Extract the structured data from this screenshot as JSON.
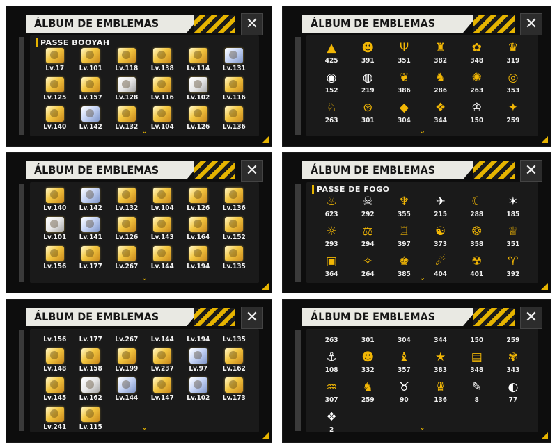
{
  "panels": [
    {
      "title": "ÁLBUM DE EMBLEMAS",
      "close_icon": "✕",
      "section": "PASSE BOOYAH",
      "kind": "levels",
      "items": [
        {
          "label": "Lv.17",
          "tone": "gold"
        },
        {
          "label": "Lv.101",
          "tone": "gold"
        },
        {
          "label": "Lv.118",
          "tone": "gold"
        },
        {
          "label": "Lv.138",
          "tone": "gold"
        },
        {
          "label": "Lv.114",
          "tone": "gold"
        },
        {
          "label": "Lv.131",
          "tone": "blue"
        },
        {
          "label": "Lv.125",
          "tone": "gold"
        },
        {
          "label": "Lv.157",
          "tone": "gold"
        },
        {
          "label": "Lv.128",
          "tone": "white"
        },
        {
          "label": "Lv.116",
          "tone": "gold"
        },
        {
          "label": "Lv.102",
          "tone": "white"
        },
        {
          "label": "Lv.116",
          "tone": "gold"
        },
        {
          "label": "Lv.140",
          "tone": "gold"
        },
        {
          "label": "Lv.142",
          "tone": "blue"
        },
        {
          "label": "Lv.132",
          "tone": "gold"
        },
        {
          "label": "Lv.104",
          "tone": "gold"
        },
        {
          "label": "Lv.126",
          "tone": "gold"
        },
        {
          "label": "Lv.136",
          "tone": "gold"
        }
      ]
    },
    {
      "title": "ÁLBUM DE EMBLEMAS",
      "close_icon": "✕",
      "section": "",
      "kind": "counts",
      "items": [
        {
          "icon": "▲",
          "label": "425",
          "tone": "gold"
        },
        {
          "icon": "☻",
          "label": "391",
          "tone": "gold"
        },
        {
          "icon": "Ψ",
          "label": "351",
          "tone": "gold"
        },
        {
          "icon": "♜",
          "label": "382",
          "tone": "gold"
        },
        {
          "icon": "✿",
          "label": "348",
          "tone": "gold"
        },
        {
          "icon": "♛",
          "label": "319",
          "tone": "gold"
        },
        {
          "icon": "◉",
          "label": "152",
          "tone": "white"
        },
        {
          "icon": "◍",
          "label": "219",
          "tone": "white"
        },
        {
          "icon": "❦",
          "label": "386",
          "tone": "gold"
        },
        {
          "icon": "♞",
          "label": "286",
          "tone": "gold"
        },
        {
          "icon": "✺",
          "label": "263",
          "tone": "gold"
        },
        {
          "icon": "◎",
          "label": "353",
          "tone": "gold"
        },
        {
          "icon": "♘",
          "label": "263",
          "tone": "gold"
        },
        {
          "icon": "⊛",
          "label": "301",
          "tone": "gold"
        },
        {
          "icon": "◆",
          "label": "304",
          "tone": "gold"
        },
        {
          "icon": "❖",
          "label": "344",
          "tone": "gold"
        },
        {
          "icon": "♔",
          "label": "150",
          "tone": "white"
        },
        {
          "icon": "✦",
          "label": "259",
          "tone": "gold"
        }
      ]
    },
    {
      "title": "ÁLBUM DE EMBLEMAS",
      "close_icon": "✕",
      "section": "",
      "kind": "levels",
      "items": [
        {
          "label": "Lv.140",
          "tone": "gold"
        },
        {
          "label": "Lv.142",
          "tone": "blue"
        },
        {
          "label": "Lv.132",
          "tone": "gold"
        },
        {
          "label": "Lv.104",
          "tone": "gold"
        },
        {
          "label": "Lv.126",
          "tone": "gold"
        },
        {
          "label": "Lv.136",
          "tone": "gold"
        },
        {
          "label": "Lv.101",
          "tone": "white"
        },
        {
          "label": "Lv.141",
          "tone": "blue"
        },
        {
          "label": "Lv.126",
          "tone": "gold"
        },
        {
          "label": "Lv.143",
          "tone": "gold"
        },
        {
          "label": "Lv.164",
          "tone": "gold"
        },
        {
          "label": "Lv.152",
          "tone": "gold"
        },
        {
          "label": "Lv.156",
          "tone": "gold"
        },
        {
          "label": "Lv.177",
          "tone": "gold"
        },
        {
          "label": "Lv.267",
          "tone": "gold"
        },
        {
          "label": "Lv.144",
          "tone": "gold"
        },
        {
          "label": "Lv.194",
          "tone": "gold"
        },
        {
          "label": "Lv.135",
          "tone": "gold"
        }
      ]
    },
    {
      "title": "ÁLBUM DE EMBLEMAS",
      "close_icon": "✕",
      "section": "PASSE DE FOGO",
      "kind": "counts",
      "items": [
        {
          "icon": "♨",
          "label": "623",
          "tone": "gold"
        },
        {
          "icon": "☠",
          "label": "292",
          "tone": "white"
        },
        {
          "icon": "♆",
          "label": "355",
          "tone": "gold"
        },
        {
          "icon": "✈",
          "label": "215",
          "tone": "white"
        },
        {
          "icon": "☾",
          "label": "288",
          "tone": "gold"
        },
        {
          "icon": "✶",
          "label": "185",
          "tone": "white"
        },
        {
          "icon": "☼",
          "label": "293",
          "tone": "gold"
        },
        {
          "icon": "⚖",
          "label": "294",
          "tone": "gold"
        },
        {
          "icon": "♖",
          "label": "397",
          "tone": "gold"
        },
        {
          "icon": "☯",
          "label": "373",
          "tone": "gold"
        },
        {
          "icon": "❂",
          "label": "358",
          "tone": "gold"
        },
        {
          "icon": "♕",
          "label": "351",
          "tone": "gold"
        },
        {
          "icon": "▣",
          "label": "364",
          "tone": "gold"
        },
        {
          "icon": "✧",
          "label": "264",
          "tone": "gold"
        },
        {
          "icon": "♚",
          "label": "385",
          "tone": "gold"
        },
        {
          "icon": "☄",
          "label": "404",
          "tone": "gold"
        },
        {
          "icon": "☢",
          "label": "401",
          "tone": "gold"
        },
        {
          "icon": "♈",
          "label": "392",
          "tone": "gold"
        }
      ]
    },
    {
      "title": "ÁLBUM DE EMBLEMAS",
      "close_icon": "✕",
      "section": "",
      "kind": "levels",
      "items": [
        {
          "label": "Lv.156",
          "tone": "none"
        },
        {
          "label": "Lv.177",
          "tone": "none"
        },
        {
          "label": "Lv.267",
          "tone": "none"
        },
        {
          "label": "Lv.144",
          "tone": "none"
        },
        {
          "label": "Lv.194",
          "tone": "none"
        },
        {
          "label": "Lv.135",
          "tone": "none"
        },
        {
          "label": "Lv.148",
          "tone": "gold"
        },
        {
          "label": "Lv.158",
          "tone": "gold"
        },
        {
          "label": "Lv.199",
          "tone": "gold"
        },
        {
          "label": "Lv.237",
          "tone": "gold"
        },
        {
          "label": "Lv.97",
          "tone": "blue"
        },
        {
          "label": "Lv.162",
          "tone": "gold"
        },
        {
          "label": "Lv.145",
          "tone": "gold"
        },
        {
          "label": "Lv.162",
          "tone": "white"
        },
        {
          "label": "Lv.144",
          "tone": "blue"
        },
        {
          "label": "Lv.147",
          "tone": "gold"
        },
        {
          "label": "Lv.102",
          "tone": "blue"
        },
        {
          "label": "Lv.173",
          "tone": "gold"
        },
        {
          "label": "Lv.241",
          "tone": "gold"
        },
        {
          "label": "Lv.115",
          "tone": "gold"
        }
      ]
    },
    {
      "title": "ÁLBUM DE EMBLEMAS",
      "close_icon": "✕",
      "section": "",
      "kind": "counts",
      "items": [
        {
          "icon": "",
          "label": "263",
          "tone": "gold"
        },
        {
          "icon": "",
          "label": "301",
          "tone": "gold"
        },
        {
          "icon": "",
          "label": "304",
          "tone": "gold"
        },
        {
          "icon": "",
          "label": "344",
          "tone": "gold"
        },
        {
          "icon": "",
          "label": "150",
          "tone": "gold"
        },
        {
          "icon": "",
          "label": "259",
          "tone": "gold"
        },
        {
          "icon": "⚓",
          "label": "108",
          "tone": "white"
        },
        {
          "icon": "☻",
          "label": "332",
          "tone": "gold"
        },
        {
          "icon": "♝",
          "label": "357",
          "tone": "gold"
        },
        {
          "icon": "★",
          "label": "383",
          "tone": "gold"
        },
        {
          "icon": "▤",
          "label": "348",
          "tone": "gold"
        },
        {
          "icon": "✾",
          "label": "343",
          "tone": "gold"
        },
        {
          "icon": "♒",
          "label": "307",
          "tone": "gold"
        },
        {
          "icon": "♞",
          "label": "259",
          "tone": "gold"
        },
        {
          "icon": "♉",
          "label": "90",
          "tone": "white"
        },
        {
          "icon": "♛",
          "label": "136",
          "tone": "gold"
        },
        {
          "icon": "✎",
          "label": "8",
          "tone": "white"
        },
        {
          "icon": "◐",
          "label": "77",
          "tone": "white"
        },
        {
          "icon": "❖",
          "label": "2",
          "tone": "white"
        }
      ]
    }
  ]
}
